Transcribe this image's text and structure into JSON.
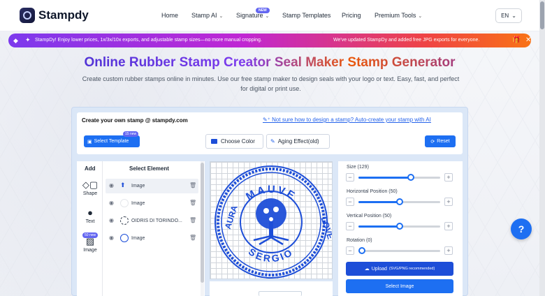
{
  "nav": {
    "brand": "Stampdy",
    "items": [
      "Home",
      "Stamp AI",
      "Signature",
      "Stamp Templates",
      "Pricing",
      "Premium Tools"
    ],
    "new_badge": "NEW",
    "lang": "EN"
  },
  "banner": {
    "left_text": "StampDy! Enjoy lower prices, 1x/3x/10x exports, and adjustable stamp sizes—no more manual cropping.",
    "right_text": "We've updated StampDy and added free JPG exports for everyone."
  },
  "hero": {
    "title": "Online Rubber Stamp Creator Seal Maker Stamp Generator",
    "subtitle": "Create custom rubber stamps online in minutes. Use our free stamp maker to design seals with your logo or text. Easy, fast, and perfect for digital or print use."
  },
  "editor": {
    "heading": "Create your own stamp @ stampdy.com",
    "ai_link": "Not sure how to design a stamp? Auto-create your stamp with AI",
    "select_template": "Select Template",
    "template_badge": "15 new",
    "choose_color": "Choose Color",
    "aging_effect": "Aging Effect(old)",
    "reset": "Reset",
    "accent": "#1d6ff2",
    "stamp_color": "#1d4ed8"
  },
  "tools": {
    "add": "Add",
    "shape": "Shape",
    "text": "Text",
    "image": "Image",
    "image_badge": "50 new"
  },
  "elements": {
    "header": "Select Element",
    "rows": [
      {
        "label": "Image"
      },
      {
        "label": "Image"
      },
      {
        "label": "OIDRIS DI TORINDO..."
      },
      {
        "label": "Image"
      }
    ]
  },
  "stamp": {
    "top_text": "MAUVE",
    "bottom_text": "SERGIO",
    "left_text": "AURA",
    "right_text": "LOVE"
  },
  "props": {
    "size": "Size (129)",
    "hpos": "Horizontal Position (50)",
    "vpos": "Vertical Position (50)",
    "rotation": "Rotation (0)",
    "size_v": 0.64,
    "hpos_v": 0.5,
    "vpos_v": 0.5,
    "rot_v": 0.0
  },
  "upload": {
    "label": "Upload",
    "hint": "(SVG/PNG recommended)"
  },
  "select_image": "Select Image"
}
